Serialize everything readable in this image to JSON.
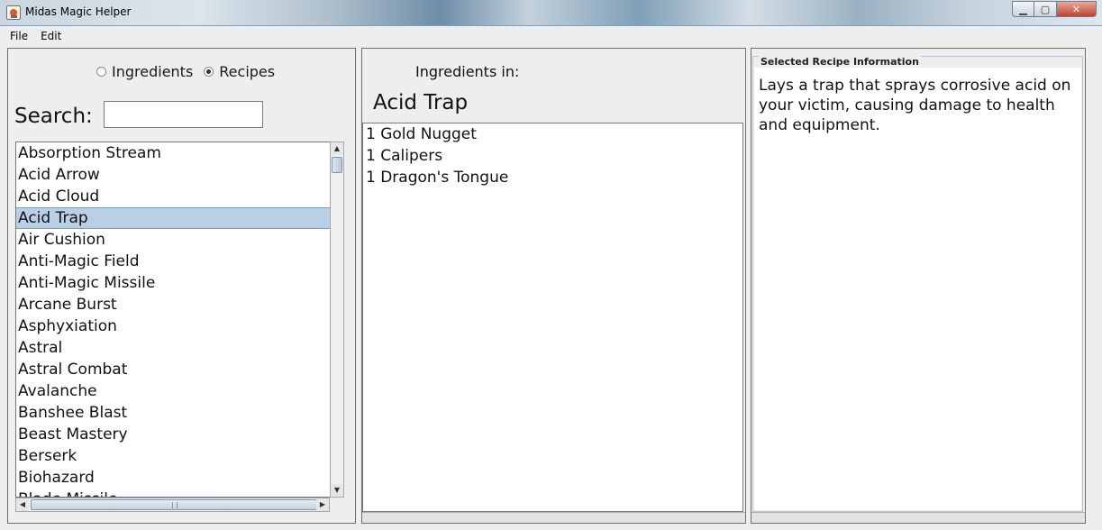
{
  "window": {
    "title": "Midas Magic Helper"
  },
  "menu": [
    "File",
    "Edit"
  ],
  "left": {
    "radio_ingredients": "Ingredients",
    "radio_recipes": "Recipes",
    "selected_mode": "Recipes",
    "search_label": "Search:",
    "search_value": "",
    "items": [
      "Absorption Stream",
      "Acid Arrow",
      "Acid Cloud",
      "Acid Trap",
      "Air Cushion",
      "Anti-Magic Field",
      "Anti-Magic Missile",
      "Arcane Burst",
      "Asphyxiation",
      "Astral",
      "Astral Combat",
      "Avalanche",
      "Banshee Blast",
      "Beast Mastery",
      "Berserk",
      "Biohazard",
      "Blade Missile"
    ],
    "selected_item": "Acid Trap"
  },
  "middle": {
    "heading": "Ingredients in:",
    "recipe_name": "Acid Trap",
    "ingredients": [
      "1 Gold Nugget",
      "1 Calipers",
      "1 Dragon's Tongue"
    ]
  },
  "right": {
    "group_title": "Selected Recipe Information",
    "description": "Lays a trap that sprays corrosive acid on your victim, causing damage to health and equipment."
  }
}
